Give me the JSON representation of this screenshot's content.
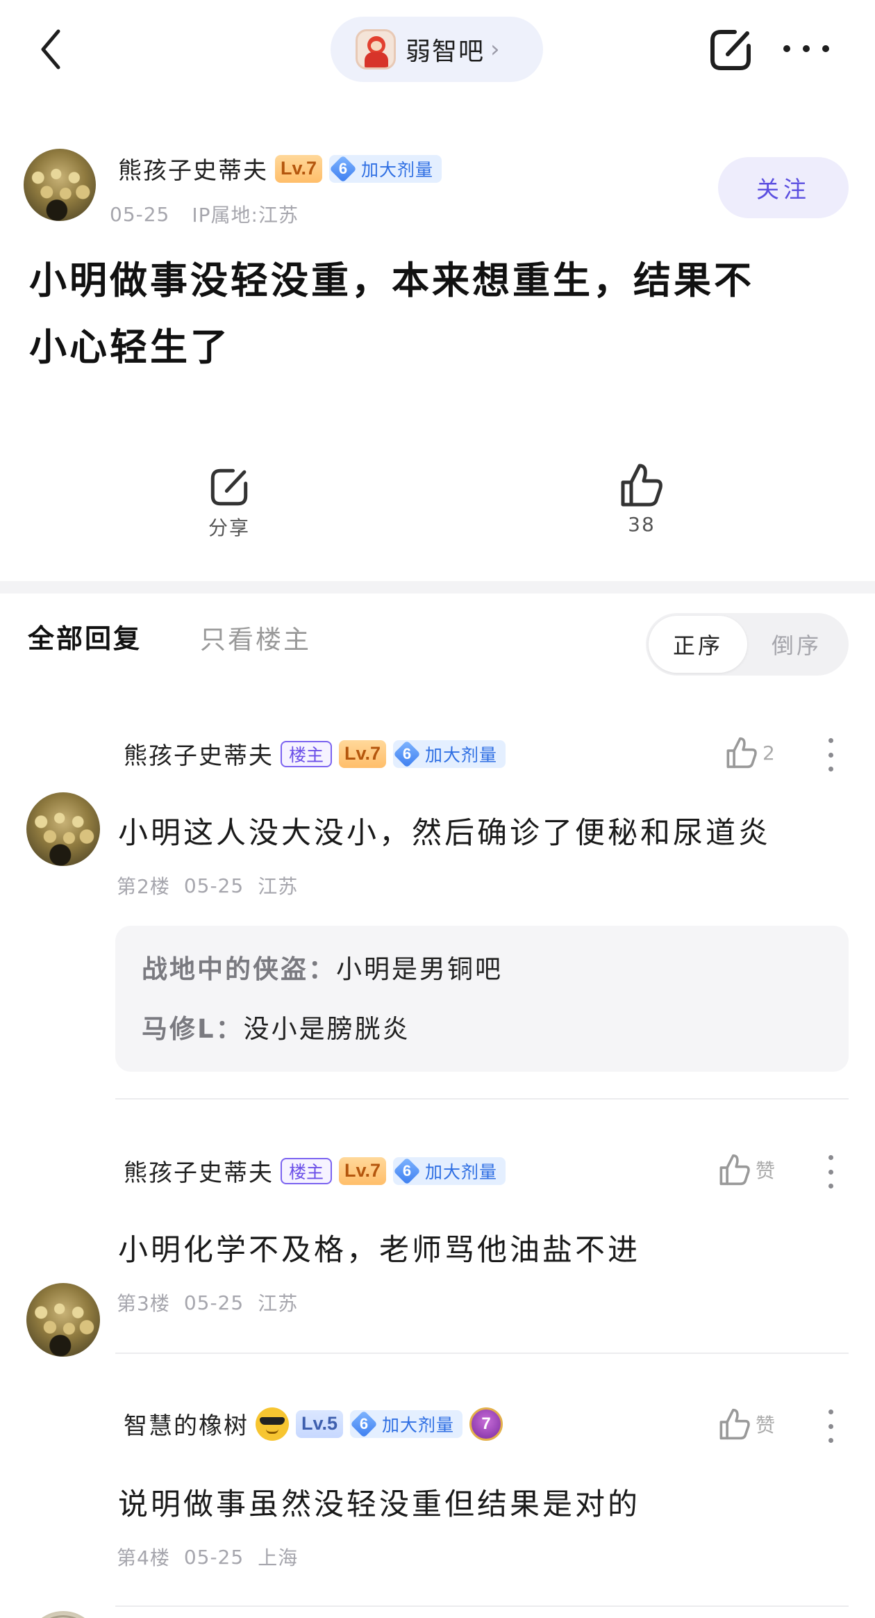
{
  "nav": {
    "forum_name": "弱智吧",
    "forum_chevron": "›"
  },
  "post": {
    "author": "熊孩子史蒂夫",
    "level": "Lv.7",
    "title_level": "6",
    "title_badge": "加大剂量",
    "date": "05-25",
    "ip": "IP属地:江苏",
    "follow_label": "关注",
    "title_line1": "小明做事没轻没重，本来想重生，结果不",
    "title_line2": "小心轻生了",
    "share_label": "分享",
    "like_count": "38"
  },
  "tabs": {
    "all": "全部回复",
    "op_only": "只看楼主",
    "sort_asc": "正序",
    "sort_desc": "倒序"
  },
  "replies": [
    {
      "author": "熊孩子史蒂夫",
      "op_badge": "楼主",
      "level": "Lv.7",
      "title_level": "6",
      "title_badge": "加大剂量",
      "like": "2",
      "text": "小明这人没大没小，然后确诊了便秘和尿道炎",
      "floor": "第2楼",
      "date": "05-25",
      "location": "江苏",
      "sub_replies": [
        {
          "who": "战地中的侠盗",
          "sep": "：",
          "text": "小明是男铜吧"
        },
        {
          "who": "马修L",
          "sep": "：",
          "text": "没小是膀胱炎"
        }
      ]
    },
    {
      "author": "熊孩子史蒂夫",
      "op_badge": "楼主",
      "level": "Lv.7",
      "title_level": "6",
      "title_badge": "加大剂量",
      "like": "赞",
      "text": "小明化学不及格，老师骂他油盐不进",
      "floor": "第3楼",
      "date": "05-25",
      "location": "江苏"
    },
    {
      "author": "智慧的橡树",
      "level": "Lv.5",
      "title_level": "6",
      "title_badge": "加大剂量",
      "medal": "7",
      "like": "赞",
      "text": "说明做事虽然没轻没重但结果是对的",
      "floor": "第4楼",
      "date": "05-25",
      "location": "上海"
    }
  ],
  "colors": {
    "accent": "#5b4fe0",
    "pill_bg": "#eef1fb",
    "title_badge_text": "#2f6fe3",
    "level_text": "#b4560d"
  }
}
